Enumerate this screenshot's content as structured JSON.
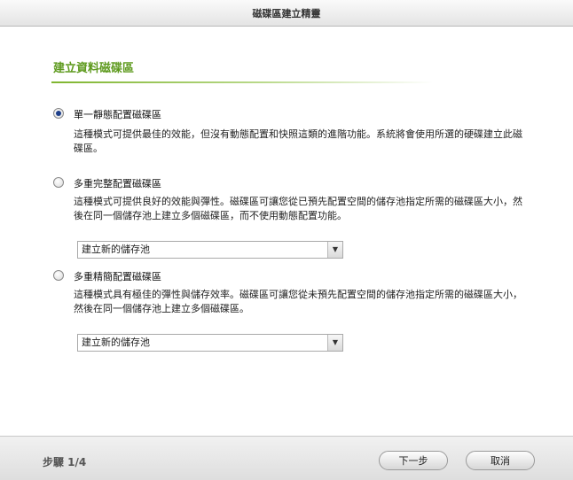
{
  "window": {
    "title": "磁碟區建立精靈"
  },
  "section": {
    "title": "建立資料磁碟區"
  },
  "options": [
    {
      "label": "單一靜態配置磁碟區",
      "description": "這種模式可提供最佳的效能，但沒有動態配置和快照這類的進階功能。系統將會使用所選的硬碟建立此磁碟區。",
      "selected": true
    },
    {
      "label": "多重完整配置磁碟區",
      "description": "這種模式可提供良好的效能與彈性。磁碟區可讓您從已預先配置空間的儲存池指定所需的磁碟區大小，然後在同一個儲存池上建立多個磁碟區，而不使用動態配置功能。",
      "selected": false,
      "pool_select": "建立新的儲存池"
    },
    {
      "label": "多重精簡配置磁碟區",
      "description": "這種模式具有極佳的彈性與儲存效率。磁碟區可讓您從未預先配置空間的儲存池指定所需的磁碟區大小，然後在同一個儲存池上建立多個磁碟區。",
      "selected": false,
      "pool_select": "建立新的儲存池"
    }
  ],
  "footer": {
    "step": "步驟 1/4",
    "next_label": "下一步",
    "cancel_label": "取消"
  },
  "icons": {
    "dropdown": "chevron-down-icon"
  },
  "colors": {
    "accent": "#5e9a1e",
    "radio_selected": "#1e3f8a"
  }
}
